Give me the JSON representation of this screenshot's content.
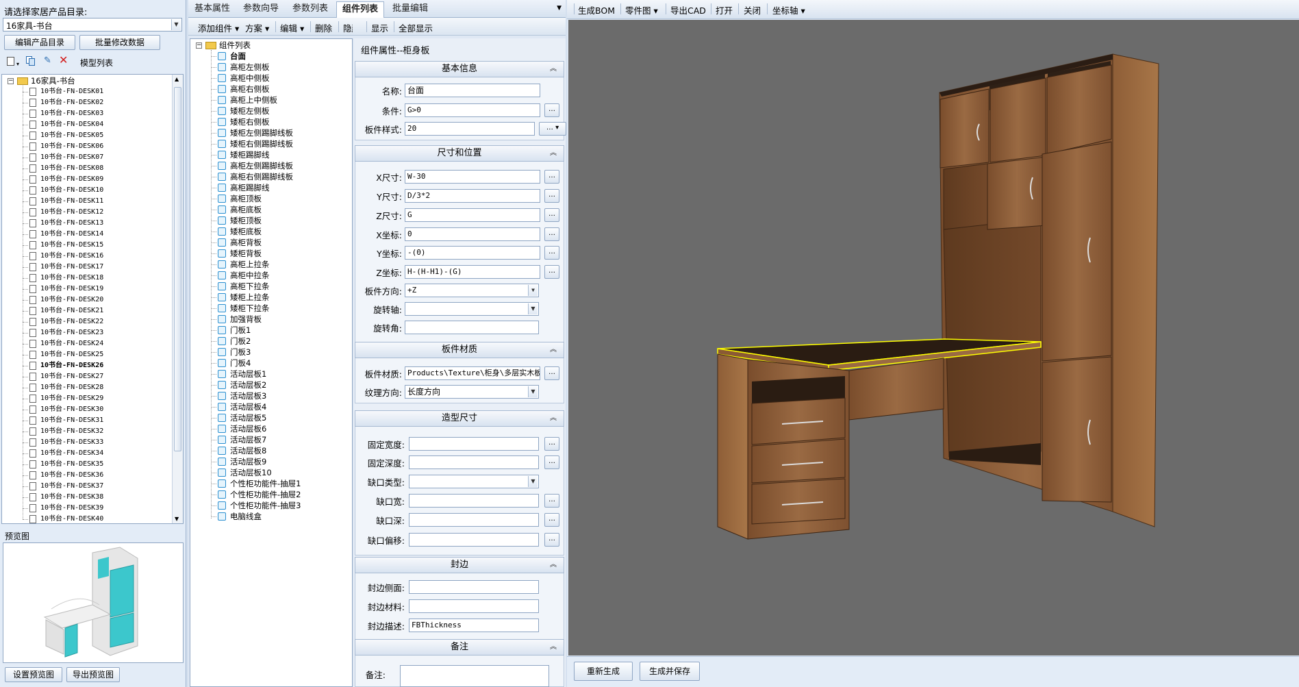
{
  "left": {
    "catalog_label": "请选择家居产品目录:",
    "catalog_value": "16家具-书台",
    "btn_edit_catalog": "编辑产品目录",
    "btn_batch_edit": "批量修改数据",
    "model_list_label": "模型列表",
    "tree_root": "16家具-书台",
    "models": [
      "10书台-FN-DESK01",
      "10书台-FN-DESK02",
      "10书台-FN-DESK03",
      "10书台-FN-DESK04",
      "10书台-FN-DESK05",
      "10书台-FN-DESK06",
      "10书台-FN-DESK07",
      "10书台-FN-DESK08",
      "10书台-FN-DESK09",
      "10书台-FN-DESK10",
      "10书台-FN-DESK11",
      "10书台-FN-DESK12",
      "10书台-FN-DESK13",
      "10书台-FN-DESK14",
      "10书台-FN-DESK15",
      "10书台-FN-DESK16",
      "10书台-FN-DESK17",
      "10书台-FN-DESK18",
      "10书台-FN-DESK19",
      "10书台-FN-DESK20",
      "10书台-FN-DESK21",
      "10书台-FN-DESK22",
      "10书台-FN-DESK23",
      "10书台-FN-DESK24",
      "10书台-FN-DESK25",
      "10书台-FN-DESK26",
      "10书台-FN-DESK27",
      "10书台-FN-DESK28",
      "10书台-FN-DESK29",
      "10书台-FN-DESK30",
      "10书台-FN-DESK31",
      "10书台-FN-DESK32",
      "10书台-FN-DESK33",
      "10书台-FN-DESK34",
      "10书台-FN-DESK35",
      "10书台-FN-DESK36",
      "10书台-FN-DESK37",
      "10书台-FN-DESK38",
      "10书台-FN-DESK39",
      "10书台-FN-DESK40"
    ],
    "selected_model": "10书台-FN-DESK26",
    "preview_label": "预览图",
    "btn_set_preview": "设置预览图",
    "btn_export_preview": "导出预览图"
  },
  "tabs": [
    "基本属性",
    "参数向导",
    "参数列表",
    "组件列表",
    "批量编辑"
  ],
  "active_tab": "组件列表",
  "component_toolbar": [
    "添加组件",
    "方案",
    "编辑",
    "删除",
    "隐藏",
    "显示",
    "全部显示"
  ],
  "component_tree": {
    "root": "组件列表",
    "items": [
      "台面",
      "高柜左侧板",
      "高柜中侧板",
      "高柜右侧板",
      "高柜上中侧板",
      "矮柜左侧板",
      "矮柜右侧板",
      "矮柜左侧踢脚线板",
      "矮柜右侧踢脚线板",
      "矮柜踢脚线",
      "高柜左侧踢脚线板",
      "高柜右侧踢脚线板",
      "高柜踢脚线",
      "高柜顶板",
      "高柜底板",
      "矮柜顶板",
      "矮柜底板",
      "高柜背板",
      "矮柜背板",
      "高柜上拉条",
      "高柜中拉条",
      "高柜下拉条",
      "矮柜上拉条",
      "矮柜下拉条",
      "加强背板",
      "门板1",
      "门板2",
      "门板3",
      "门板4",
      "活动层板1",
      "活动层板2",
      "活动层板3",
      "活动层板4",
      "活动层板5",
      "活动层板6",
      "活动层板7",
      "活动层板8",
      "活动层板9",
      "活动层板10",
      "个性柜功能件-抽屉1",
      "个性柜功能件-抽屉2",
      "个性柜功能件-抽屉3",
      "电脑线盒"
    ],
    "selected": "台面"
  },
  "props": {
    "title": "组件属性--柜身板",
    "basic": {
      "header": "基本信息",
      "name_label": "名称:",
      "name_value": "台面",
      "cond_label": "条件:",
      "cond_value": "G>0",
      "style_label": "板件样式:",
      "style_value": "20"
    },
    "size": {
      "header": "尺寸和位置",
      "x_label": "X尺寸:",
      "x_value": "W-30",
      "y_label": "Y尺寸:",
      "y_value": "D/3*2",
      "z_label": "Z尺寸:",
      "z_value": "G",
      "xc_label": "X坐标:",
      "xc_value": "0",
      "yc_label": "Y坐标:",
      "yc_value": "-(0)",
      "zc_label": "Z坐标:",
      "zc_value": "H-(H-H1)-(G)",
      "dir_label": "板件方向:",
      "dir_value": "+Z",
      "axis_label": "旋转轴:",
      "axis_value": "",
      "angle_label": "旋转角:",
      "angle_value": ""
    },
    "material": {
      "header": "板件材质",
      "mat_label": "板件材质:",
      "mat_value": "Products\\Texture\\柜身\\多层实木板",
      "grain_label": "纹理方向:",
      "grain_value": "长度方向"
    },
    "shape": {
      "header": "造型尺寸",
      "fw_label": "固定宽度:",
      "fd_label": "固定深度:",
      "notch_type_label": "缺口类型:",
      "notch_w_label": "缺口宽:",
      "notch_d_label": "缺口深:",
      "notch_off_label": "缺口偏移:"
    },
    "edge": {
      "header": "封边",
      "side_label": "封边侧面:",
      "mat_label": "封边材料:",
      "desc_label": "封边描述:",
      "desc_value": "FBThickness"
    },
    "note": {
      "header": "备注",
      "note_label": "备注:"
    }
  },
  "right_toolbar": [
    "生成BOM",
    "零件图",
    "导出CAD",
    "打开",
    "关闭",
    "坐标轴"
  ],
  "bottom_buttons": {
    "regen": "重新生成",
    "regen_save": "生成并保存"
  },
  "colors": {
    "viewport_bg": "#6b6b6b",
    "wood": "#8a5a34",
    "highlight": "#ffff00",
    "accent": "#2a8fd0"
  }
}
